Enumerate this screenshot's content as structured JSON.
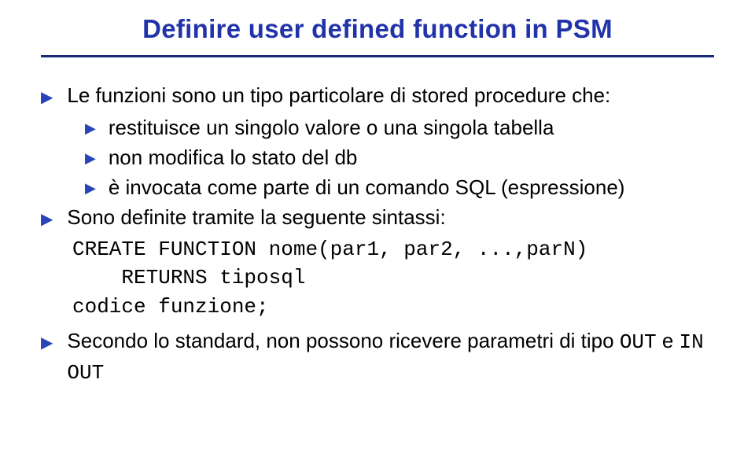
{
  "title": "Definire user defined function in PSM",
  "bullets": {
    "b1_1": "Le funzioni sono un tipo particolare di stored procedure che:",
    "b2_1": "restituisce un singolo valore o una singola tabella",
    "b2_2": "non modifica lo stato del db",
    "b2_3": "è invocata come parte di un comando SQL (espressione)",
    "b1_2": "Sono definite tramite la seguente sintassi:",
    "code_l1": "CREATE FUNCTION nome(par1, par2, ...,parN)",
    "code_l2": "    RETURNS tiposql",
    "code_l3": "codice funzione;",
    "b1_3_pre": "Secondo lo standard, non possono ricevere parametri di tipo ",
    "b1_3_out": "OUT",
    "b1_3_mid": " e ",
    "b1_3_inout": "IN OUT"
  }
}
